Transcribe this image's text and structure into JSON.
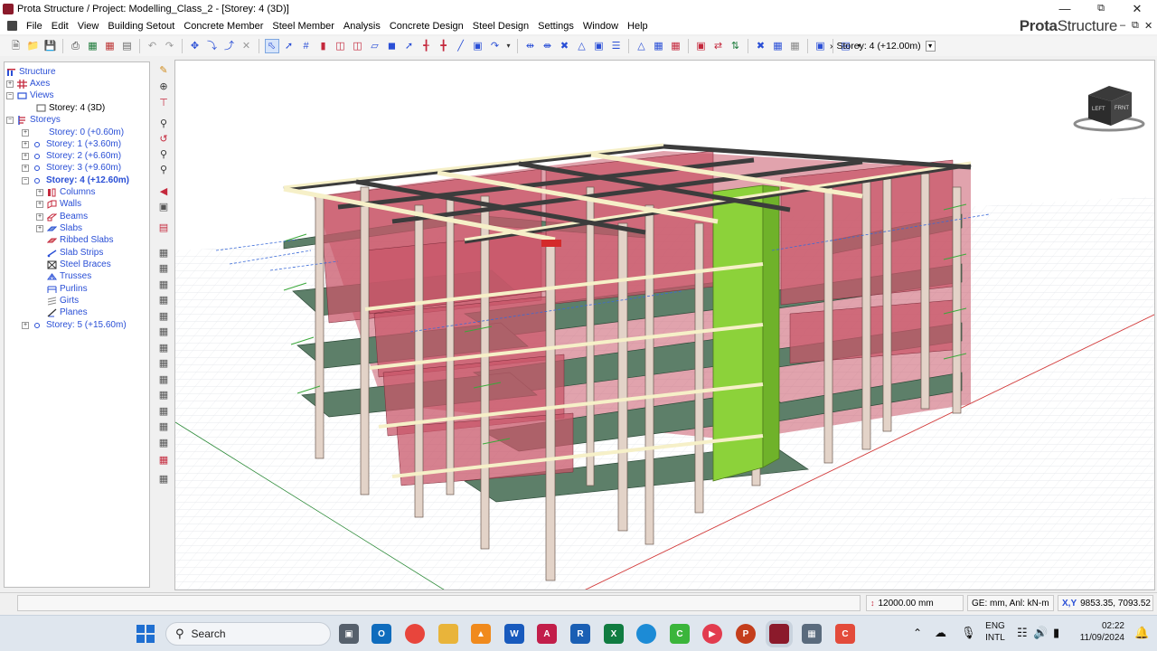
{
  "window": {
    "title": "Prota Structure / Project: Modelling_Class_2 - [Storey: 4 (3D)]",
    "controls": {
      "minimize": "—",
      "maximize": "⧉",
      "close": "✕"
    },
    "mdi_controls": {
      "minimize": "–",
      "restore": "⧉",
      "close": "✕"
    }
  },
  "brand": {
    "bold": "Prota",
    "light": "Structure"
  },
  "menu": [
    "File",
    "Edit",
    "View",
    "Building Setout",
    "Concrete Member",
    "Steel Member",
    "Analysis",
    "Concrete Design",
    "Steel Design",
    "Settings",
    "Window",
    "Help"
  ],
  "toolbar": {
    "storey_selector": "Storey: 4 (+12.00m)",
    "storey_prefix": "›"
  },
  "tree": {
    "root": "Structure",
    "axes": "Axes",
    "views": "Views",
    "view_item": "Storey: 4 (3D)",
    "storeys": "Storeys",
    "storey_items": [
      "Storey: 0 (+0.60m)",
      "Storey: 1 (+3.60m)",
      "Storey: 2 (+6.60m)",
      "Storey: 3 (+9.60m)",
      "Storey: 4 (+12.60m)"
    ],
    "storey4_children": [
      "Columns",
      "Walls",
      "Beams",
      "Slabs",
      "Ribbed Slabs",
      "Slab Strips",
      "Steel Braces",
      "Trusses",
      "Purlins",
      "Girts",
      "Planes"
    ],
    "storey5": "Storey: 5 (+15.60m)"
  },
  "viewcube": {
    "left": "LEFT",
    "front": "FRNT"
  },
  "status": {
    "grid_size": "12000.00 mm",
    "units": "GE: mm,  Anl: kN-m",
    "coords_label": "X,Y",
    "coords": "9853.35, 7093.52"
  },
  "taskbar": {
    "search": "Search",
    "language": "ENG",
    "layout": "INTL",
    "time": "02:22",
    "date": "11/09/2024"
  },
  "colors": {
    "slab_green": "#5d7f69",
    "wall_red": "#c8576a",
    "beam_cream": "#f6f0c8",
    "core_green": "#8cd23a",
    "column": "#e3d3c8"
  }
}
